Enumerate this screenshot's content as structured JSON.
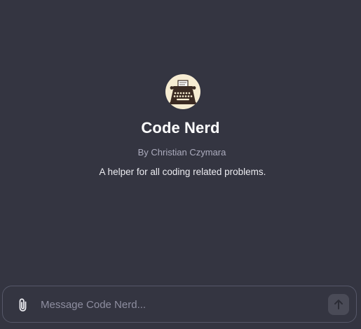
{
  "gpt": {
    "name": "Code Nerd",
    "author": "By Christian Czymara",
    "description": "A helper for all coding related problems.",
    "avatar_icon": "typewriter-icon"
  },
  "composer": {
    "placeholder": "Message Code Nerd...",
    "value": "",
    "attach_icon": "paperclip-icon",
    "send_icon": "arrow-up-icon"
  },
  "colors": {
    "background": "#343541",
    "avatar_background": "#f6ecd2",
    "composer_border": "#565869",
    "send_button_disabled": "#4a4b57"
  }
}
